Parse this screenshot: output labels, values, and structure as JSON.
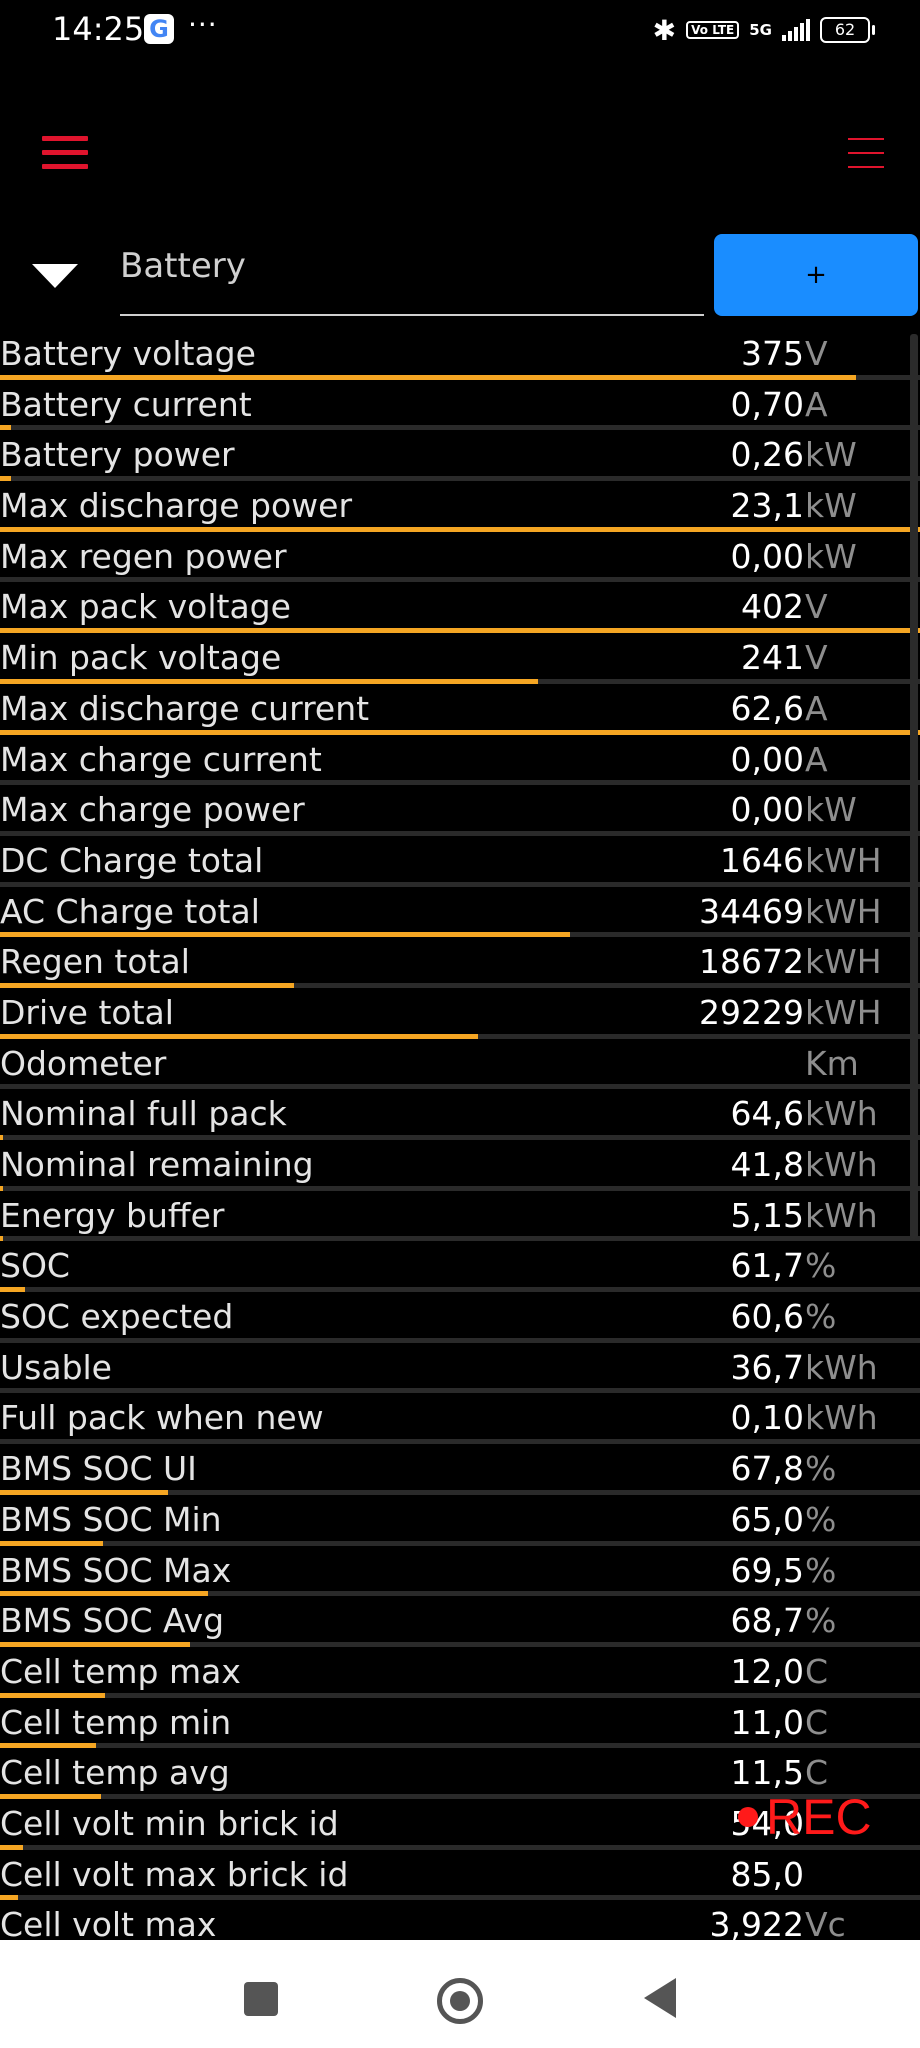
{
  "status_bar": {
    "time": "14:25",
    "notification_icon": "google-icon",
    "more_dots": "···",
    "bluetooth_icon": "bluetooth-icon",
    "volte": "Vo LTE",
    "network": "5G",
    "battery": "62"
  },
  "toolbar": {
    "left_menu_icon": "hamburger-menu-icon",
    "right_menu_icon": "overflow-menu-icon"
  },
  "selector": {
    "value": "Battery",
    "add_label": "+"
  },
  "colors": {
    "accent_bar": "#f5a623",
    "menu_red": "#e0142d",
    "button_blue": "#1a8dff",
    "rec_red": "#ff1a1a"
  },
  "rows": [
    {
      "label": "Battery voltage",
      "value": "375",
      "unit": "V",
      "level": 0.93
    },
    {
      "label": "Battery current",
      "value": "0,70",
      "unit": "A",
      "level": 0.012
    },
    {
      "label": "Battery power",
      "value": "0,26",
      "unit": "kW",
      "level": 0.012
    },
    {
      "label": "Max discharge power",
      "value": "23,1",
      "unit": "kW",
      "level": 1.0
    },
    {
      "label": "Max regen power",
      "value": "0,00",
      "unit": "kW",
      "level": 0.0
    },
    {
      "label": "Max pack voltage",
      "value": "402",
      "unit": "V",
      "level": 1.0
    },
    {
      "label": "Min pack voltage",
      "value": "241",
      "unit": "V",
      "level": 0.585
    },
    {
      "label": "Max discharge current",
      "value": "62,6",
      "unit": "A",
      "level": 1.0
    },
    {
      "label": "Max charge current",
      "value": "0,00",
      "unit": "A",
      "level": 0.0
    },
    {
      "label": "Max charge power",
      "value": "0,00",
      "unit": "kW",
      "level": 0.0
    },
    {
      "label": "DC Charge total",
      "value": "1646",
      "unit": "kWH",
      "level": 0.0
    },
    {
      "label": "AC Charge total",
      "value": "34469",
      "unit": "kWH",
      "level": 0.62
    },
    {
      "label": "Regen total",
      "value": "18672",
      "unit": "kWH",
      "level": 0.32
    },
    {
      "label": "Drive total",
      "value": "29229",
      "unit": "kWH",
      "level": 0.52
    },
    {
      "label": "Odometer",
      "value": "",
      "unit": "Km",
      "level": 0.0
    },
    {
      "label": "Nominal full pack",
      "value": "64,6",
      "unit": "kWh",
      "level": 0.003
    },
    {
      "label": "Nominal remaining",
      "value": "41,8",
      "unit": "kWh",
      "level": 0.003
    },
    {
      "label": "Energy buffer",
      "value": "5,15",
      "unit": "kWh",
      "level": 0.003
    },
    {
      "label": "SOC",
      "value": "61,7",
      "unit": "%",
      "level": 0.027
    },
    {
      "label": "SOC expected",
      "value": "60,6",
      "unit": "%",
      "level": 0.0
    },
    {
      "label": "Usable",
      "value": "36,7",
      "unit": "kWh",
      "level": 0.0
    },
    {
      "label": "Full pack when new",
      "value": "0,10",
      "unit": "kWh",
      "level": 0.0
    },
    {
      "label": "BMS SOC UI",
      "value": "67,8",
      "unit": "%",
      "level": 0.183
    },
    {
      "label": "BMS SOC Min",
      "value": "65,0",
      "unit": "%",
      "level": 0.112
    },
    {
      "label": "BMS SOC Max",
      "value": "69,5",
      "unit": "%",
      "level": 0.226
    },
    {
      "label": "BMS SOC Avg",
      "value": "68,7",
      "unit": "%",
      "level": 0.206
    },
    {
      "label": "Cell temp max",
      "value": "12,0",
      "unit": "C",
      "level": 0.114
    },
    {
      "label": "Cell temp min",
      "value": "11,0",
      "unit": "C",
      "level": 0.104
    },
    {
      "label": "Cell temp avg",
      "value": "11,5",
      "unit": "C",
      "level": 0.11
    },
    {
      "label": "Cell volt min brick id",
      "value": "54,0",
      "unit": "",
      "level": 0.025
    },
    {
      "label": "Cell volt max brick id",
      "value": "85,0",
      "unit": "",
      "level": 0.02
    },
    {
      "label": "Cell volt max",
      "value": "3,922",
      "unit": "Vc",
      "level": 0.0
    }
  ],
  "recording": {
    "label": "REC"
  },
  "nav": {
    "recents_icon": "recents-square-icon",
    "home_icon": "home-circle-icon",
    "back_icon": "back-triangle-icon"
  }
}
